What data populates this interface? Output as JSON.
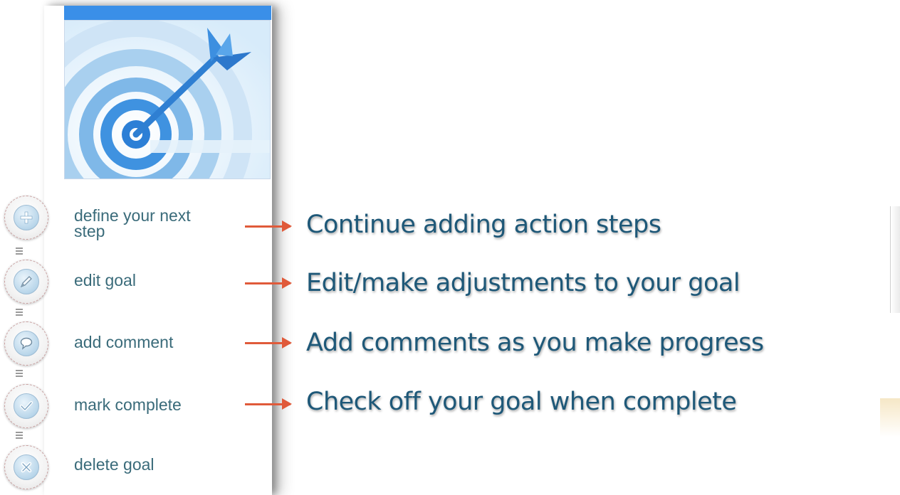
{
  "panel": {
    "hero_icon": "target-dart-icon",
    "colors": {
      "accent_bar": "#3a8fe8",
      "label": "#3a6b7a"
    }
  },
  "actions": [
    {
      "icon": "plus-icon",
      "label_line1": "define your next",
      "label_line2": "step"
    },
    {
      "icon": "pencil-icon",
      "label_line1": "edit goal",
      "label_line2": ""
    },
    {
      "icon": "comment-icon",
      "label_line1": "add comment",
      "label_line2": ""
    },
    {
      "icon": "checkmark-icon",
      "label_line1": "mark complete",
      "label_line2": ""
    },
    {
      "icon": "x-icon",
      "label_line1": "delete goal",
      "label_line2": ""
    }
  ],
  "annotations": [
    "Continue adding action steps",
    "Edit/make adjustments to your goal",
    "Add comments as you make progress",
    "Check off your goal when complete"
  ],
  "annotation_color": "#1e5878",
  "arrow_color": "#e05a3a"
}
